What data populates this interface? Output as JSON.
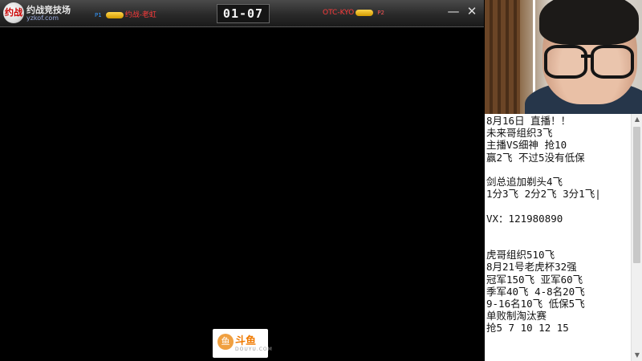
{
  "game_window": {
    "logo_mark": "约战",
    "logo_title": "约战竞技场",
    "logo_url": "yzkof.com",
    "player1": {
      "tag": "P1",
      "name": "约战-老虹"
    },
    "player2": {
      "tag": "P2",
      "name": "OTC-KYO"
    },
    "score": "01-07",
    "minimize_label": "—",
    "close_label": "✕"
  },
  "watermark": {
    "mark": "鱼",
    "text": "斗鱼",
    "sub": "DOUYU.COM"
  },
  "notes": {
    "lines": [
      "8月16日 直播！！",
      "未来哥组织3飞",
      "主播VS细神 抢10",
      "赢2飞 不过5没有低保",
      "",
      "剑总追加剃头4飞",
      "1分3飞 2分2飞 3分1飞|",
      "",
      "VX：121980890",
      "",
      "",
      "虎哥组织510飞",
      "8月21号老虎杯32强",
      "冠军150飞 亚军60飞",
      "季军40飞 4-8名20飞",
      "9-16名10飞 低保5飞",
      "单败制淘汰赛",
      "抢5 7 10 12 15"
    ]
  },
  "scrollbar": {
    "up": "▲",
    "down": "▼"
  }
}
